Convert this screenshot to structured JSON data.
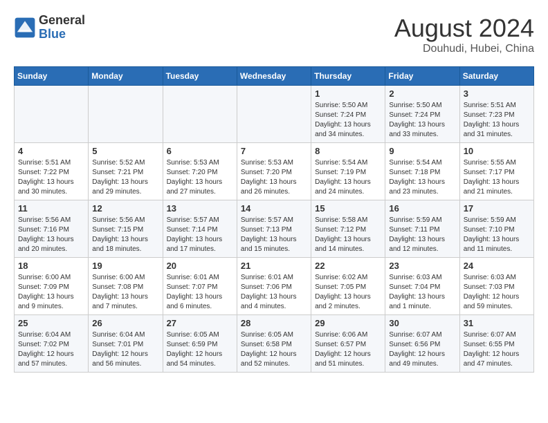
{
  "header": {
    "logo_general": "General",
    "logo_blue": "Blue",
    "month": "August 2024",
    "location": "Douhudi, Hubei, China"
  },
  "weekdays": [
    "Sunday",
    "Monday",
    "Tuesday",
    "Wednesday",
    "Thursday",
    "Friday",
    "Saturday"
  ],
  "weeks": [
    [
      {
        "day": "",
        "info": ""
      },
      {
        "day": "",
        "info": ""
      },
      {
        "day": "",
        "info": ""
      },
      {
        "day": "",
        "info": ""
      },
      {
        "day": "1",
        "info": "Sunrise: 5:50 AM\nSunset: 7:24 PM\nDaylight: 13 hours\nand 34 minutes."
      },
      {
        "day": "2",
        "info": "Sunrise: 5:50 AM\nSunset: 7:24 PM\nDaylight: 13 hours\nand 33 minutes."
      },
      {
        "day": "3",
        "info": "Sunrise: 5:51 AM\nSunset: 7:23 PM\nDaylight: 13 hours\nand 31 minutes."
      }
    ],
    [
      {
        "day": "4",
        "info": "Sunrise: 5:51 AM\nSunset: 7:22 PM\nDaylight: 13 hours\nand 30 minutes."
      },
      {
        "day": "5",
        "info": "Sunrise: 5:52 AM\nSunset: 7:21 PM\nDaylight: 13 hours\nand 29 minutes."
      },
      {
        "day": "6",
        "info": "Sunrise: 5:53 AM\nSunset: 7:20 PM\nDaylight: 13 hours\nand 27 minutes."
      },
      {
        "day": "7",
        "info": "Sunrise: 5:53 AM\nSunset: 7:20 PM\nDaylight: 13 hours\nand 26 minutes."
      },
      {
        "day": "8",
        "info": "Sunrise: 5:54 AM\nSunset: 7:19 PM\nDaylight: 13 hours\nand 24 minutes."
      },
      {
        "day": "9",
        "info": "Sunrise: 5:54 AM\nSunset: 7:18 PM\nDaylight: 13 hours\nand 23 minutes."
      },
      {
        "day": "10",
        "info": "Sunrise: 5:55 AM\nSunset: 7:17 PM\nDaylight: 13 hours\nand 21 minutes."
      }
    ],
    [
      {
        "day": "11",
        "info": "Sunrise: 5:56 AM\nSunset: 7:16 PM\nDaylight: 13 hours\nand 20 minutes."
      },
      {
        "day": "12",
        "info": "Sunrise: 5:56 AM\nSunset: 7:15 PM\nDaylight: 13 hours\nand 18 minutes."
      },
      {
        "day": "13",
        "info": "Sunrise: 5:57 AM\nSunset: 7:14 PM\nDaylight: 13 hours\nand 17 minutes."
      },
      {
        "day": "14",
        "info": "Sunrise: 5:57 AM\nSunset: 7:13 PM\nDaylight: 13 hours\nand 15 minutes."
      },
      {
        "day": "15",
        "info": "Sunrise: 5:58 AM\nSunset: 7:12 PM\nDaylight: 13 hours\nand 14 minutes."
      },
      {
        "day": "16",
        "info": "Sunrise: 5:59 AM\nSunset: 7:11 PM\nDaylight: 13 hours\nand 12 minutes."
      },
      {
        "day": "17",
        "info": "Sunrise: 5:59 AM\nSunset: 7:10 PM\nDaylight: 13 hours\nand 11 minutes."
      }
    ],
    [
      {
        "day": "18",
        "info": "Sunrise: 6:00 AM\nSunset: 7:09 PM\nDaylight: 13 hours\nand 9 minutes."
      },
      {
        "day": "19",
        "info": "Sunrise: 6:00 AM\nSunset: 7:08 PM\nDaylight: 13 hours\nand 7 minutes."
      },
      {
        "day": "20",
        "info": "Sunrise: 6:01 AM\nSunset: 7:07 PM\nDaylight: 13 hours\nand 6 minutes."
      },
      {
        "day": "21",
        "info": "Sunrise: 6:01 AM\nSunset: 7:06 PM\nDaylight: 13 hours\nand 4 minutes."
      },
      {
        "day": "22",
        "info": "Sunrise: 6:02 AM\nSunset: 7:05 PM\nDaylight: 13 hours\nand 2 minutes."
      },
      {
        "day": "23",
        "info": "Sunrise: 6:03 AM\nSunset: 7:04 PM\nDaylight: 13 hours\nand 1 minute."
      },
      {
        "day": "24",
        "info": "Sunrise: 6:03 AM\nSunset: 7:03 PM\nDaylight: 12 hours\nand 59 minutes."
      }
    ],
    [
      {
        "day": "25",
        "info": "Sunrise: 6:04 AM\nSunset: 7:02 PM\nDaylight: 12 hours\nand 57 minutes."
      },
      {
        "day": "26",
        "info": "Sunrise: 6:04 AM\nSunset: 7:01 PM\nDaylight: 12 hours\nand 56 minutes."
      },
      {
        "day": "27",
        "info": "Sunrise: 6:05 AM\nSunset: 6:59 PM\nDaylight: 12 hours\nand 54 minutes."
      },
      {
        "day": "28",
        "info": "Sunrise: 6:05 AM\nSunset: 6:58 PM\nDaylight: 12 hours\nand 52 minutes."
      },
      {
        "day": "29",
        "info": "Sunrise: 6:06 AM\nSunset: 6:57 PM\nDaylight: 12 hours\nand 51 minutes."
      },
      {
        "day": "30",
        "info": "Sunrise: 6:07 AM\nSunset: 6:56 PM\nDaylight: 12 hours\nand 49 minutes."
      },
      {
        "day": "31",
        "info": "Sunrise: 6:07 AM\nSunset: 6:55 PM\nDaylight: 12 hours\nand 47 minutes."
      }
    ]
  ]
}
